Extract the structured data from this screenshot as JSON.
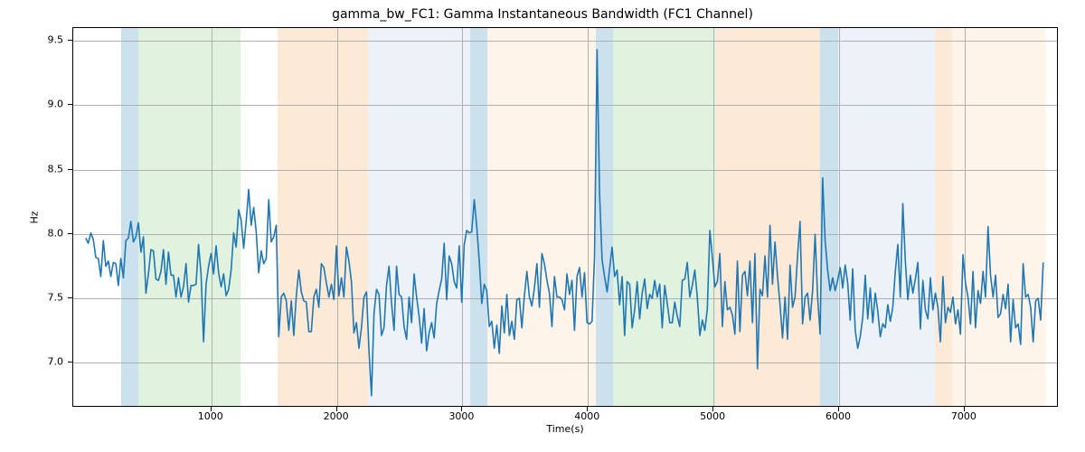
{
  "chart_data": {
    "type": "line",
    "title": "gamma_bw_FC1: Gamma Instantaneous Bandwidth (FC1 Channel)",
    "xlabel": "Time(s)",
    "ylabel": "Hz",
    "xlim": [
      -100,
      7750
    ],
    "ylim": [
      6.65,
      9.6
    ],
    "xticks": [
      1000,
      2000,
      3000,
      4000,
      5000,
      6000,
      7000
    ],
    "yticks": [
      7.0,
      7.5,
      8.0,
      8.5,
      9.0,
      9.5
    ],
    "bands": [
      {
        "x0": 280,
        "x1": 420,
        "color": "#6aa8cf"
      },
      {
        "x0": 420,
        "x1": 1230,
        "color": "#a9d9a2"
      },
      {
        "x0": 1530,
        "x1": 2250,
        "color": "#f6c38a"
      },
      {
        "x0": 2250,
        "x1": 3060,
        "color": "#c9d9ec"
      },
      {
        "x0": 3060,
        "x1": 3200,
        "color": "#6aa8cf"
      },
      {
        "x0": 3200,
        "x1": 4060,
        "color": "#fbe0c3"
      },
      {
        "x0": 4060,
        "x1": 4200,
        "color": "#6aa8cf"
      },
      {
        "x0": 4200,
        "x1": 5020,
        "color": "#a9d9a2"
      },
      {
        "x0": 5020,
        "x1": 5850,
        "color": "#f6c38a"
      },
      {
        "x0": 5850,
        "x1": 5990,
        "color": "#6aa8cf"
      },
      {
        "x0": 5990,
        "x1": 6760,
        "color": "#c9d9ec"
      },
      {
        "x0": 6760,
        "x1": 6900,
        "color": "#f6c38a"
      },
      {
        "x0": 6900,
        "x1": 7650,
        "color": "#fbe0c3"
      }
    ],
    "series": [
      {
        "name": "gamma_bw_FC1",
        "color": "#1f77b4",
        "x_step": 20,
        "y": [
          7.96,
          7.92,
          8.0,
          7.95,
          7.81,
          7.8,
          7.66,
          7.94,
          7.74,
          7.78,
          7.66,
          7.77,
          7.76,
          7.59,
          7.8,
          7.65,
          7.94,
          7.96,
          8.09,
          7.93,
          7.97,
          8.08,
          7.85,
          7.97,
          7.53,
          7.68,
          7.87,
          7.86,
          7.64,
          7.63,
          7.7,
          7.87,
          7.6,
          7.85,
          7.67,
          7.67,
          7.5,
          7.65,
          7.5,
          7.58,
          7.76,
          7.46,
          7.59,
          7.59,
          7.6,
          7.91,
          7.68,
          7.15,
          7.6,
          7.74,
          7.84,
          7.68,
          7.9,
          7.69,
          7.58,
          7.68,
          7.51,
          7.56,
          7.71,
          8.0,
          7.89,
          8.18,
          8.1,
          7.88,
          8.09,
          8.34,
          8.06,
          8.2,
          8.01,
          7.69,
          7.86,
          7.76,
          7.8,
          8.26,
          7.93,
          7.97,
          8.06,
          7.19,
          7.5,
          7.53,
          7.47,
          7.24,
          7.47,
          7.2,
          7.51,
          7.71,
          7.54,
          7.47,
          7.46,
          7.23,
          7.23,
          7.5,
          7.56,
          7.42,
          7.76,
          7.73,
          7.61,
          7.5,
          7.6,
          7.48,
          7.9,
          7.51,
          7.65,
          7.5,
          7.89,
          7.78,
          7.62,
          7.22,
          7.3,
          7.1,
          7.26,
          7.5,
          7.54,
          7.08,
          6.73,
          7.37,
          7.56,
          7.52,
          7.2,
          7.26,
          7.59,
          7.74,
          7.45,
          7.24,
          7.74,
          7.52,
          7.5,
          7.27,
          7.17,
          7.5,
          7.3,
          7.68,
          7.5,
          7.35,
          7.14,
          7.41,
          7.08,
          7.22,
          7.3,
          7.18,
          7.45,
          7.55,
          7.64,
          7.92,
          7.48,
          7.82,
          7.76,
          7.62,
          7.57,
          7.9,
          7.46,
          7.91,
          8.02,
          8.0,
          8.01,
          8.26,
          8.05,
          7.78,
          7.45,
          7.6,
          7.55,
          7.27,
          7.31,
          7.1,
          7.28,
          7.06,
          7.43,
          7.22,
          7.52,
          7.2,
          7.31,
          7.17,
          7.48,
          7.49,
          7.26,
          7.51,
          7.7,
          7.5,
          7.43,
          7.57,
          7.76,
          7.42,
          7.84,
          7.76,
          7.63,
          7.53,
          7.27,
          7.66,
          7.5,
          7.5,
          7.48,
          7.4,
          7.68,
          7.52,
          7.63,
          7.24,
          7.66,
          7.73,
          7.5,
          7.69,
          7.3,
          7.29,
          7.31,
          7.82,
          9.43,
          8.31,
          7.79,
          7.66,
          7.54,
          7.72,
          7.89,
          7.66,
          7.71,
          7.44,
          7.66,
          7.2,
          7.62,
          7.6,
          7.26,
          7.4,
          7.62,
          7.33,
          7.53,
          7.64,
          7.41,
          7.52,
          7.49,
          7.63,
          7.5,
          7.6,
          7.26,
          7.59,
          7.45,
          7.3,
          7.3,
          7.46,
          7.35,
          7.27,
          7.63,
          7.64,
          7.77,
          7.5,
          7.59,
          7.71,
          7.5,
          7.2,
          7.32,
          7.24,
          7.41,
          8.02,
          7.81,
          7.58,
          7.62,
          7.84,
          7.27,
          7.62,
          7.4,
          7.42,
          7.36,
          7.21,
          7.78,
          7.23,
          7.67,
          7.7,
          7.51,
          7.78,
          7.3,
          7.84,
          6.94,
          7.56,
          7.51,
          7.82,
          7.5,
          8.06,
          7.6,
          7.93,
          7.66,
          7.44,
          7.18,
          7.5,
          7.17,
          7.75,
          7.42,
          7.5,
          7.82,
          8.09,
          7.29,
          7.5,
          7.53,
          7.32,
          7.55,
          7.99,
          7.5,
          7.21,
          8.43,
          7.94,
          7.71,
          7.55,
          7.65,
          7.55,
          7.63,
          7.73,
          7.57,
          7.75,
          7.61,
          7.32,
          7.72,
          7.24,
          7.1,
          7.19,
          7.34,
          7.67,
          7.33,
          7.57,
          7.3,
          7.53,
          7.39,
          7.19,
          7.29,
          7.26,
          7.44,
          7.31,
          7.42,
          7.7,
          7.91,
          7.5,
          8.23,
          7.78,
          7.48,
          7.67,
          7.53,
          7.64,
          7.77,
          7.25,
          7.63,
          7.4,
          7.33,
          7.65,
          7.4,
          7.53,
          7.42,
          7.15,
          7.66,
          7.3,
          7.42,
          7.38,
          7.5,
          7.29,
          7.4,
          7.21,
          7.83,
          7.61,
          7.5,
          7.29,
          7.7,
          7.26,
          7.55,
          7.45,
          7.7,
          7.5,
          8.05,
          7.67,
          7.5,
          7.67,
          7.34,
          7.37,
          7.52,
          7.41,
          7.6,
          7.15,
          7.48,
          7.26,
          7.29,
          7.13,
          7.76,
          7.5,
          7.52,
          7.42,
          7.15,
          7.47,
          7.49,
          7.32,
          7.77
        ]
      }
    ]
  }
}
